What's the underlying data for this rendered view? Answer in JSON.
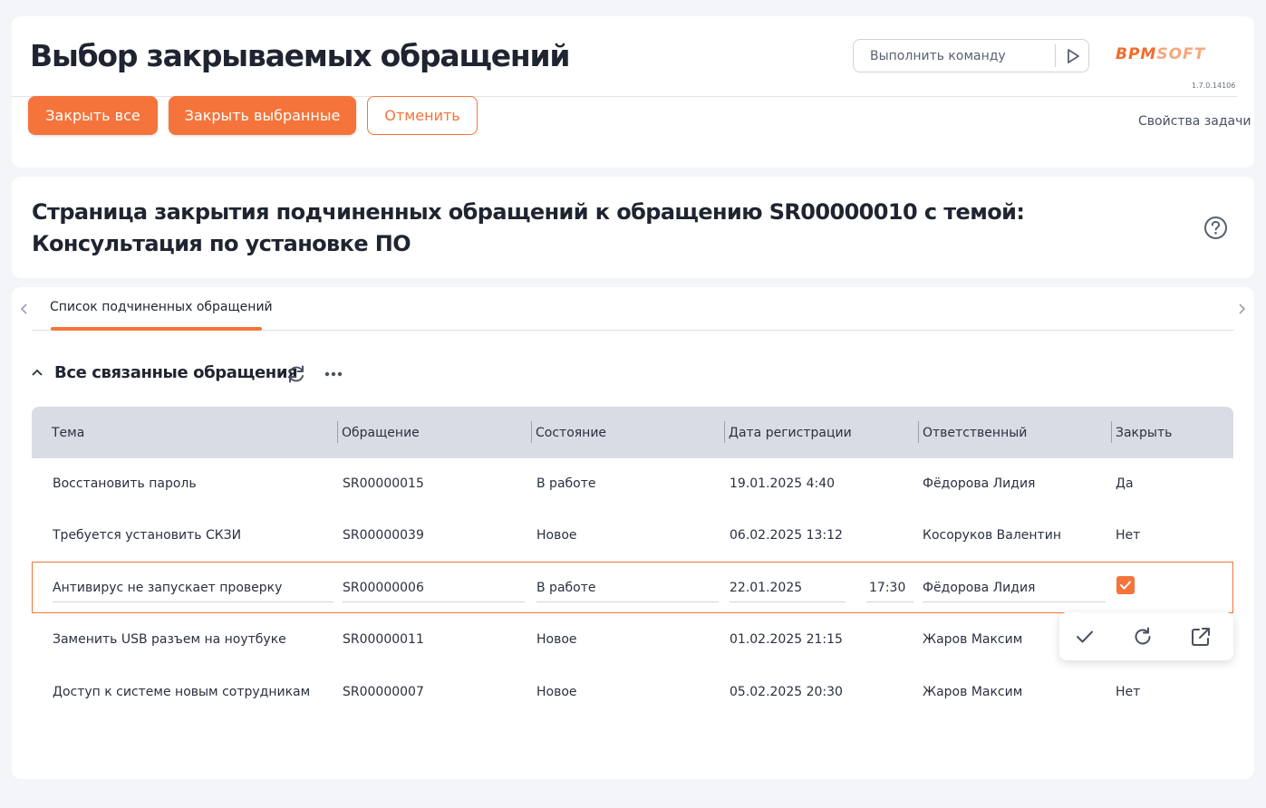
{
  "header": {
    "title": "Выбор закрываемых обращений",
    "command_placeholder": "Выполнить команду",
    "logo_part1": "BPM",
    "logo_part2": "SOFT",
    "version": "1.7.0.14106",
    "buttons": {
      "close_all": "Закрыть все",
      "close_selected": "Закрыть выбранные",
      "cancel": "Отменить"
    },
    "task_properties": "Свойства задачи"
  },
  "subtitle": "Страница закрытия подчиненных обращений к обращению SR00000010 с темой: Консультация по установке ПО",
  "tabs": [
    {
      "label": "Список подчиненных обращений",
      "active": true
    }
  ],
  "group": {
    "title": "Все связанные обращения",
    "icons": [
      "chevron-up-icon",
      "refresh-icon",
      "more-dots-icon"
    ]
  },
  "table": {
    "columns": [
      "Тема",
      "Обращение",
      "Состояние",
      "Дата регистрации",
      "Ответственный",
      "Закрыть"
    ],
    "rows": [
      {
        "subject": "Восстановить пароль",
        "number": "SR00000015",
        "status": "В работе",
        "date": "19.01.2025 4:40",
        "owner": "Фёдорова Лидия",
        "close": "Да"
      },
      {
        "subject": "Требуется установить СКЗИ",
        "number": "SR00000039",
        "status": "Новое",
        "date": "06.02.2025 13:12",
        "owner": "Косоруков Валентин",
        "close": "Нет"
      },
      {
        "subject": "Антивирус не запускает проверку",
        "number": "SR00000006",
        "status": "В работе",
        "date": "22.01.2025",
        "time": "17:30",
        "owner": "Фёдорова Лидия",
        "close": "checked"
      },
      {
        "subject": "Заменить USB разъем на ноутбуке",
        "number": "SR00000011",
        "status": "Новое",
        "date": "01.02.2025 21:15",
        "owner": "Жаров Максим",
        "close": ""
      },
      {
        "subject": "Доступ к системе новым сотрудникам",
        "number": "SR00000007",
        "status": "Новое",
        "date": "05.02.2025 20:30",
        "owner": "Жаров Максим",
        "close": "Нет"
      }
    ]
  },
  "row_actions": [
    "check-icon",
    "reload-icon",
    "open-external-icon"
  ],
  "colors": {
    "accent": "#f4743b",
    "header_bg": "#d9dce4",
    "page_bg": "#f4f5f9"
  }
}
